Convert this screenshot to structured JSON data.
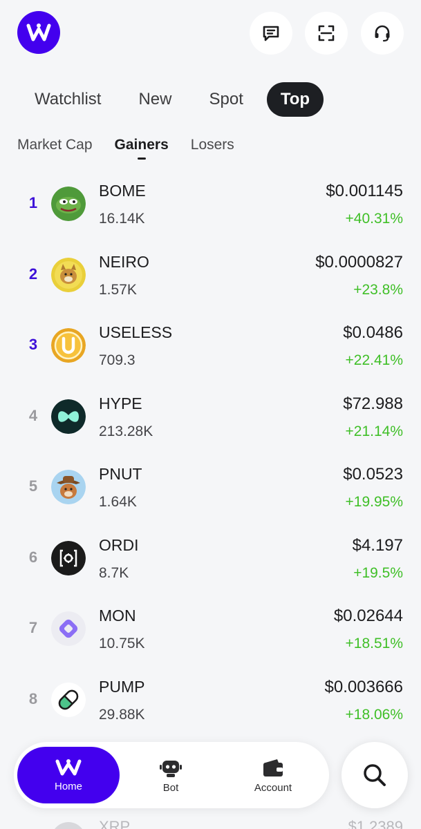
{
  "header": {
    "logo_icon": "wallet-w-logo",
    "buttons": [
      "message-icon",
      "scan-icon",
      "headset-icon"
    ]
  },
  "tabs": [
    {
      "label": "Watchlist",
      "active": false
    },
    {
      "label": "New",
      "active": false
    },
    {
      "label": "Spot",
      "active": false
    },
    {
      "label": "Top",
      "active": true
    }
  ],
  "subtabs": [
    {
      "label": "Market Cap",
      "active": false
    },
    {
      "label": "Gainers",
      "active": true
    },
    {
      "label": "Losers",
      "active": false
    }
  ],
  "tokens": [
    {
      "rank": "1",
      "symbol": "BOME",
      "volume": "16.14K",
      "price": "$0.001145",
      "change": "+40.31%",
      "icon": "bome-icon"
    },
    {
      "rank": "2",
      "symbol": "NEIRO",
      "volume": "1.57K",
      "price": "$0.0000827",
      "change": "+23.8%",
      "icon": "neiro-icon"
    },
    {
      "rank": "3",
      "symbol": "USELESS",
      "volume": "709.3",
      "price": "$0.0486",
      "change": "+22.41%",
      "icon": "useless-icon"
    },
    {
      "rank": "4",
      "symbol": "HYPE",
      "volume": "213.28K",
      "price": "$72.988",
      "change": "+21.14%",
      "icon": "hype-icon"
    },
    {
      "rank": "5",
      "symbol": "PNUT",
      "volume": "1.64K",
      "price": "$0.0523",
      "change": "+19.95%",
      "icon": "pnut-icon"
    },
    {
      "rank": "6",
      "symbol": "ORDI",
      "volume": "8.7K",
      "price": "$4.197",
      "change": "+19.5%",
      "icon": "ordi-icon"
    },
    {
      "rank": "7",
      "symbol": "MON",
      "volume": "10.75K",
      "price": "$0.02644",
      "change": "+18.51%",
      "icon": "mon-icon"
    },
    {
      "rank": "8",
      "symbol": "PUMP",
      "volume": "29.88K",
      "price": "$0.003666",
      "change": "+18.06%",
      "icon": "pump-icon"
    }
  ],
  "partial_row": {
    "symbol": "XRP",
    "price": "$1.2389"
  },
  "nav": {
    "home": "Home",
    "bot": "Bot",
    "account": "Account"
  },
  "colors": {
    "brand": "#4300ee",
    "positive": "#3fbf27",
    "top_rank": "#3d10d8"
  }
}
